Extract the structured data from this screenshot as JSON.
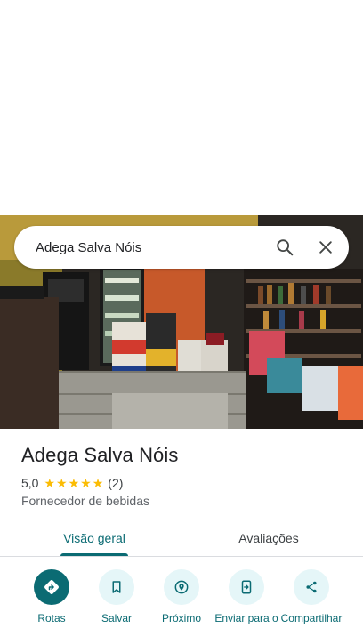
{
  "search": {
    "query": "Adega Salva Nóis",
    "search_icon": "search-icon",
    "close_icon": "close-icon"
  },
  "place": {
    "name": "Adega Salva Nóis",
    "rating": "5,0",
    "stars": 5,
    "review_count": "(2)",
    "category": "Fornecedor de bebidas"
  },
  "tabs": [
    {
      "label": "Visão geral",
      "active": true
    },
    {
      "label": "Avaliações",
      "active": false
    }
  ],
  "actions": [
    {
      "label": "Rotas",
      "icon": "directions-icon"
    },
    {
      "label": "Salvar",
      "icon": "bookmark-icon"
    },
    {
      "label": "Próximo",
      "icon": "nearby-icon"
    },
    {
      "label": "Enviar para o",
      "icon": "send-to-phone-icon"
    },
    {
      "label": "Compartilhar",
      "icon": "share-icon"
    }
  ],
  "colors": {
    "accent": "#0b6b73",
    "accent_light": "#e5f6f8",
    "star": "#fbbc04",
    "text_primary": "#202124",
    "text_secondary": "#5f6368"
  }
}
